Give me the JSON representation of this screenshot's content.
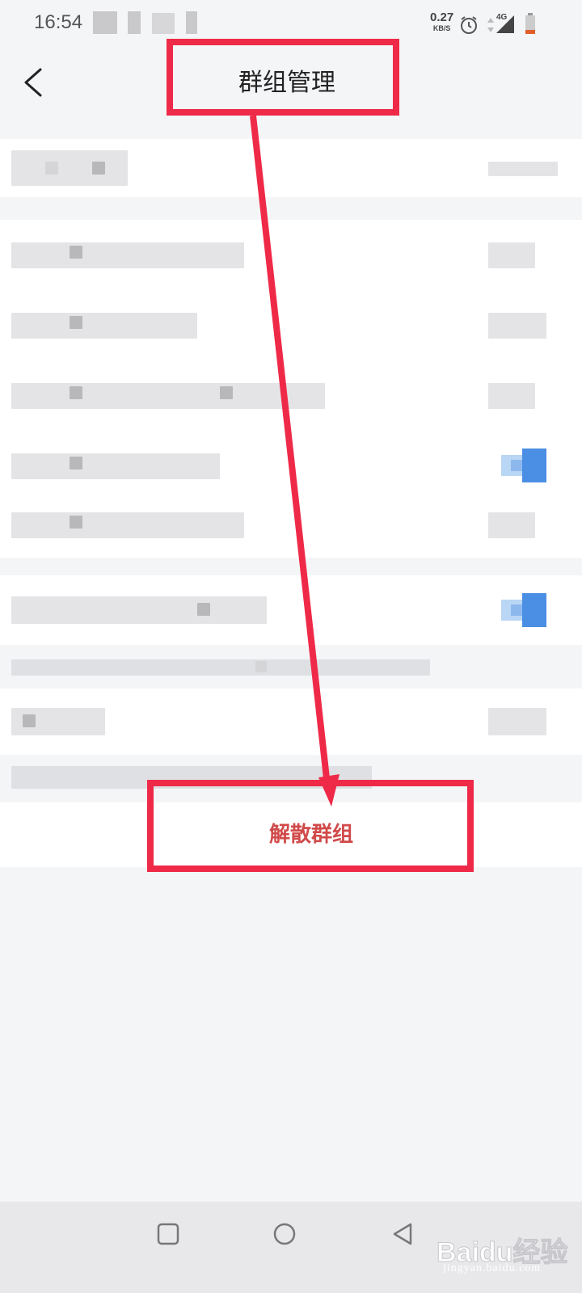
{
  "status_bar": {
    "time": "16:54",
    "net_speed_value": "0.27",
    "net_speed_unit": "KB/S",
    "signal_label": "4G"
  },
  "header": {
    "title": "群组管理"
  },
  "actions": {
    "disband_label": "解散群组"
  },
  "watermark": {
    "brand": "Baidu经验",
    "url": "jingyan.baidu.com"
  },
  "colors": {
    "annotation": "#ef2a48",
    "danger_text": "#d14a4a",
    "toggle_on": "#4a8fe3",
    "page_background": "#f4f5f7"
  },
  "icons": {
    "back": "chevron-left-icon",
    "alarm": "alarm-icon",
    "signal": "signal-icon",
    "battery": "battery-icon",
    "recent": "square-icon",
    "home": "circle-icon",
    "back_nav": "triangle-left-icon"
  }
}
